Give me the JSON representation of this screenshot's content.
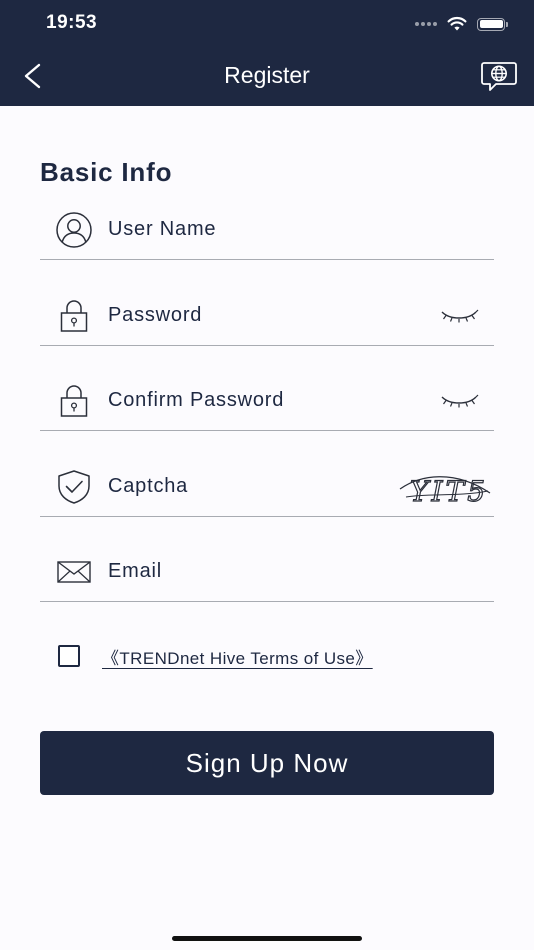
{
  "status_bar": {
    "time": "19:53"
  },
  "header": {
    "title": "Register"
  },
  "form": {
    "section_title": "Basic Info",
    "username": {
      "placeholder": "User Name",
      "value": ""
    },
    "password": {
      "placeholder": "Password",
      "value": ""
    },
    "confirm_password": {
      "placeholder": "Confirm Password",
      "value": ""
    },
    "captcha": {
      "placeholder": "Captcha",
      "value": "",
      "image_text": "YIT5"
    },
    "email": {
      "placeholder": "Email",
      "value": ""
    }
  },
  "terms": {
    "checked": false,
    "link_label": "《TRENDnet Hive Terms of Use》"
  },
  "actions": {
    "signup_label": "Sign Up Now"
  },
  "icons": {
    "back": "chevron-left-icon",
    "language": "globe-chat-icon",
    "user": "user-icon",
    "lock": "lock-icon",
    "eye_closed": "eye-closed-icon",
    "shield": "shield-check-icon",
    "mail": "mail-icon"
  },
  "colors": {
    "primary": "#1e2841",
    "background": "#fcfbfe",
    "divider": "#a8abb2"
  }
}
